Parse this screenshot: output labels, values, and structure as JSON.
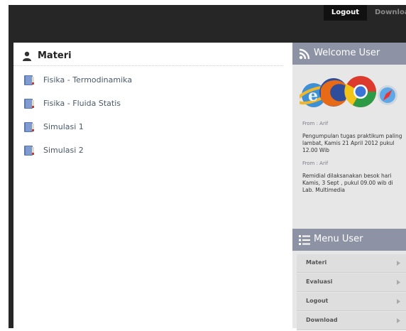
{
  "topnav": {
    "links": [
      {
        "label": "Logout"
      },
      {
        "label": "Download"
      }
    ]
  },
  "main": {
    "title": "Materi",
    "items": [
      {
        "label": "Fisika - Termodinamika"
      },
      {
        "label": "Fisika - Fluida Statis"
      },
      {
        "label": "Simulasi 1"
      },
      {
        "label": "Simulasi 2"
      }
    ]
  },
  "sidebar": {
    "welcome_title": "Welcome User",
    "messages": [
      {
        "from": "From : Arif",
        "body": "Pengumpulan tugas praktikum paling lambat, Kamis 21 April 2012 pukul 12.00 Wib"
      },
      {
        "from": "From : Arif",
        "body": "Remidial dilaksanakan besok hari Kamis, 3 Sept , pukul 09.00 wib di Lab. Multimedia"
      }
    ],
    "menu_title": "Menu User",
    "menu_items": [
      {
        "label": "Materi"
      },
      {
        "label": "Evaluasi"
      },
      {
        "label": "Logout"
      },
      {
        "label": "Download"
      }
    ]
  },
  "icons": {
    "user": "user-icon",
    "book": "book-icon",
    "rss": "rss-icon",
    "list": "list-icon",
    "arrow": "arrow-right-icon",
    "browsers": "browser-logos"
  },
  "colors": {
    "topbar": "#262626",
    "panel_header": "#8d93a4",
    "sidebar_bg": "#e7e7e7",
    "link_text": "#4a5a6a"
  }
}
